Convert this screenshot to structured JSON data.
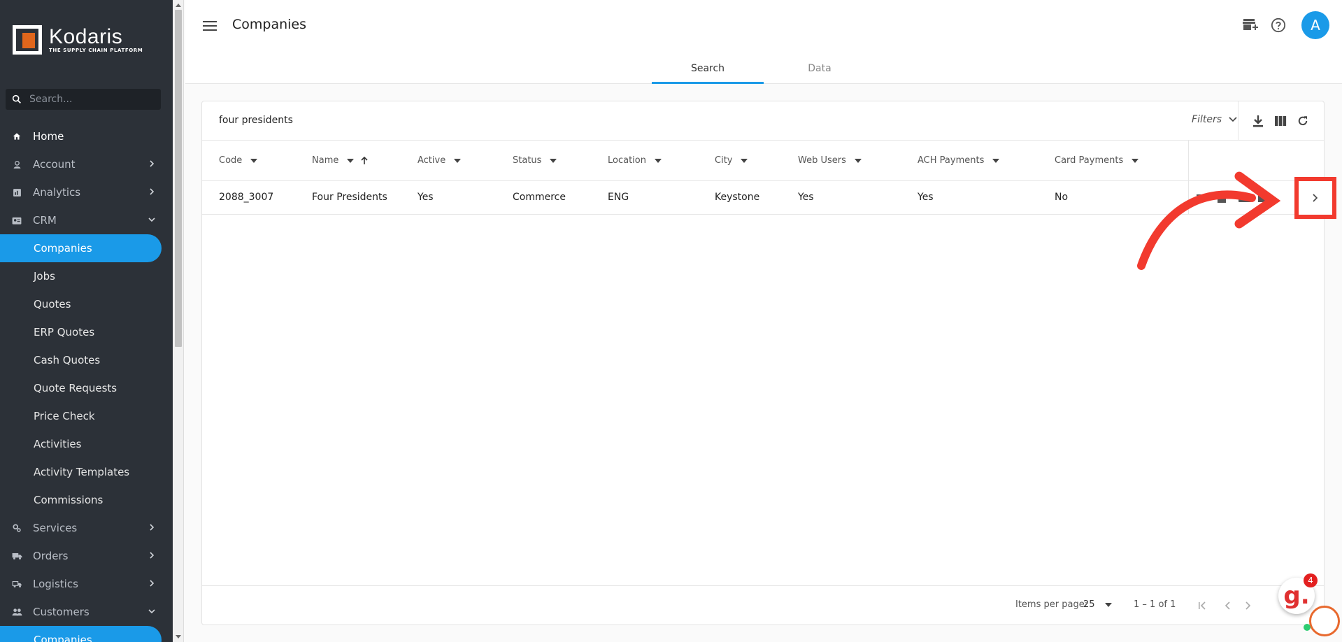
{
  "brand": {
    "name": "Kodaris",
    "tagline": "THE SUPPLY CHAIN PLATFORM"
  },
  "sidebar": {
    "search_placeholder": "Search...",
    "items": [
      {
        "label": "Home",
        "icon": "home-icon"
      },
      {
        "label": "Account",
        "icon": "person-icon"
      },
      {
        "label": "Analytics",
        "icon": "analytics-icon"
      },
      {
        "label": "CRM",
        "icon": "crm-icon"
      },
      {
        "label": "Companies"
      },
      {
        "label": "Jobs"
      },
      {
        "label": "Quotes"
      },
      {
        "label": "ERP Quotes"
      },
      {
        "label": "Cash Quotes"
      },
      {
        "label": "Quote Requests"
      },
      {
        "label": "Price Check"
      },
      {
        "label": "Activities"
      },
      {
        "label": "Activity Templates"
      },
      {
        "label": "Commissions"
      },
      {
        "label": "Services",
        "icon": "gears-icon"
      },
      {
        "label": "Orders",
        "icon": "truck-icon"
      },
      {
        "label": "Logistics",
        "icon": "shipping-icon"
      },
      {
        "label": "Customers",
        "icon": "group-icon"
      },
      {
        "label": "Companies"
      }
    ]
  },
  "header": {
    "title": "Companies",
    "avatar_initial": "A"
  },
  "tabs": [
    {
      "label": "Search"
    },
    {
      "label": "Data"
    }
  ],
  "search": {
    "query": "four presidents",
    "filters_label": "Filters"
  },
  "table": {
    "columns": [
      "Code",
      "Name",
      "Active",
      "Status",
      "Location",
      "City",
      "Web Users",
      "ACH Payments",
      "Card Payments"
    ],
    "rows": [
      {
        "code": "2088_3007",
        "name": "Four Presidents",
        "active": "Yes",
        "status": "Commerce",
        "location": "ENG",
        "city": "Keystone",
        "web_users": "Yes",
        "ach": "Yes",
        "card": "No"
      }
    ]
  },
  "pagination": {
    "items_per_page_label": "Items per page:",
    "items_per_page": "25",
    "range": "1 – 1 of 1"
  },
  "chat": {
    "badge": "4",
    "letter": "g."
  },
  "colors": {
    "sidebar_bg": "#2c3138",
    "accent": "#1a9ae8",
    "highlight": "#f23a2e"
  }
}
